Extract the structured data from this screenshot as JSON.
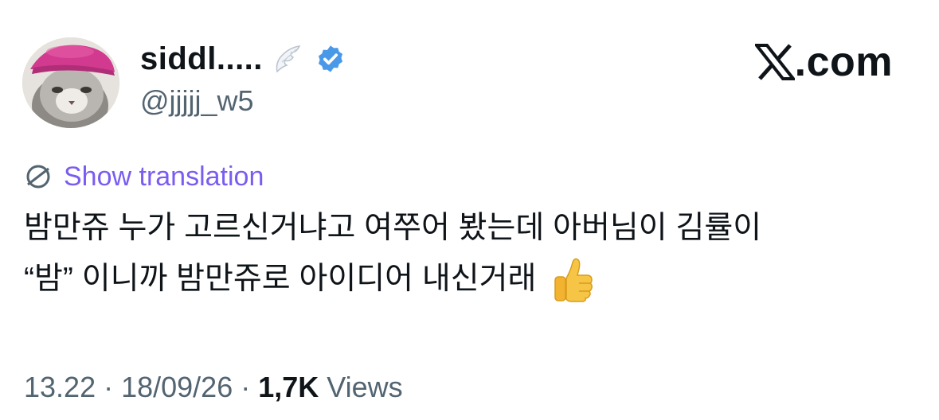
{
  "author": {
    "display_name": "siddl.....",
    "handle": "@jjjjj_w5",
    "badge_icon": "wing-emoji-icon",
    "verified_icon": "verified-badge-icon",
    "verified_color": "#4a99e9"
  },
  "brand": {
    "domain": ".com",
    "logo_icon": "x-logo-icon"
  },
  "translation": {
    "icon": "globe-icon",
    "label": "Show translation",
    "color": "#7b5cf0"
  },
  "tweet": {
    "lines": [
      "밤만쥬 누가 고르신거냐고 여쭈어 봤는데 아버님이 김률이",
      "“밤” 이니까 밤만쥬로 아이디어 내신거래"
    ],
    "emoji": "thumbs-up-icon"
  },
  "meta": {
    "time": "13.22",
    "separator": "·",
    "date": "18/09/26",
    "views_count": "1,7K",
    "views_label": "Views"
  }
}
